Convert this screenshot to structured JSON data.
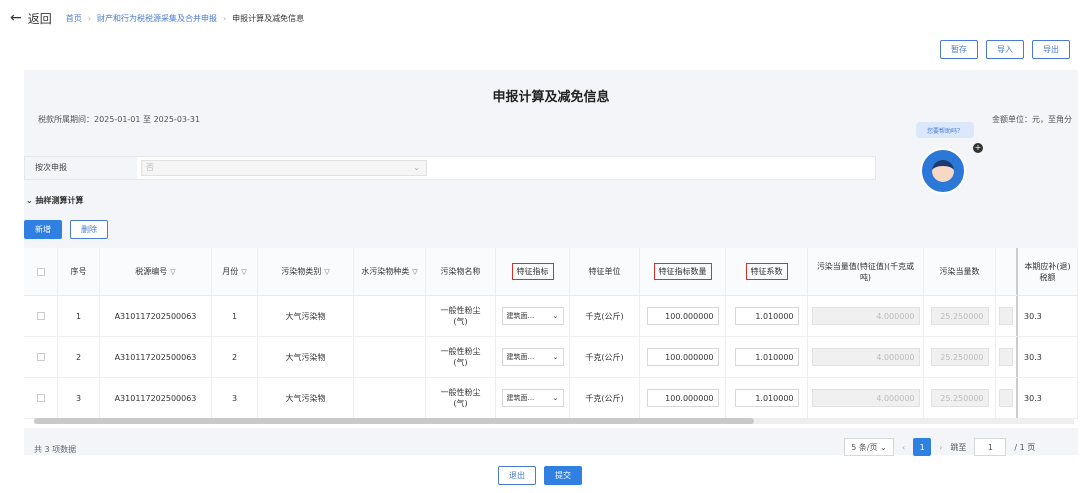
{
  "nav": {
    "back_label": "返回",
    "breadcrumb": [
      "首页",
      "财产和行为税税源采集及合并申报",
      "申报计算及减免信息"
    ]
  },
  "toolbar": {
    "save": "暂存",
    "import": "导入",
    "export": "导出"
  },
  "page": {
    "title": "申报计算及减免信息",
    "period": "税款所属期间：2025-01-01 至 2025-03-31",
    "unit": "金额单位：元，至角分",
    "help": "您要帮助吗？"
  },
  "filter": {
    "label": "按次申报",
    "value": "否"
  },
  "section": {
    "title": "抽样测算计算",
    "add": "新增",
    "delete": "删除"
  },
  "table": {
    "headers": [
      "序号",
      "税源编号",
      "月份",
      "污染物类别",
      "水污染物种类",
      "污染物名称",
      "特征指标",
      "特征单位",
      "特征指标数量",
      "特征系数",
      "污染当量值(特征值)(千克或吨)",
      "污染当量数",
      "",
      "本期应补(退)税额"
    ],
    "rows": [
      {
        "seq": "1",
        "source": "A310117202500063",
        "month": "1",
        "category": "大气污染物",
        "water": "",
        "pollutant": "一般性粉尘(气)",
        "indicator": "建筑面...",
        "unit": "千克(公斤)",
        "qty": "100.000000",
        "coef": "1.010000",
        "equiv": "4.000000",
        "equiv_num": "25.250000",
        "tax": "30.3"
      },
      {
        "seq": "2",
        "source": "A310117202500063",
        "month": "2",
        "category": "大气污染物",
        "water": "",
        "pollutant": "一般性粉尘(气)",
        "indicator": "建筑面...",
        "unit": "千克(公斤)",
        "qty": "100.000000",
        "coef": "1.010000",
        "equiv": "4.000000",
        "equiv_num": "25.250000",
        "tax": "30.3"
      },
      {
        "seq": "3",
        "source": "A310117202500063",
        "month": "3",
        "category": "大气污染物",
        "water": "",
        "pollutant": "一般性粉尘(气)",
        "indicator": "建筑面...",
        "unit": "千克(公斤)",
        "qty": "100.000000",
        "coef": "1.010000",
        "equiv": "4.000000",
        "equiv_num": "25.250000",
        "tax": "30.3"
      }
    ]
  },
  "pagination": {
    "total": "共 3 项数据",
    "page_size": "5 条/页",
    "current": "1",
    "jump_label": "跳至",
    "jump_value": "1",
    "pages": "/ 1 页"
  },
  "footer": {
    "exit": "退出",
    "submit": "提交"
  }
}
